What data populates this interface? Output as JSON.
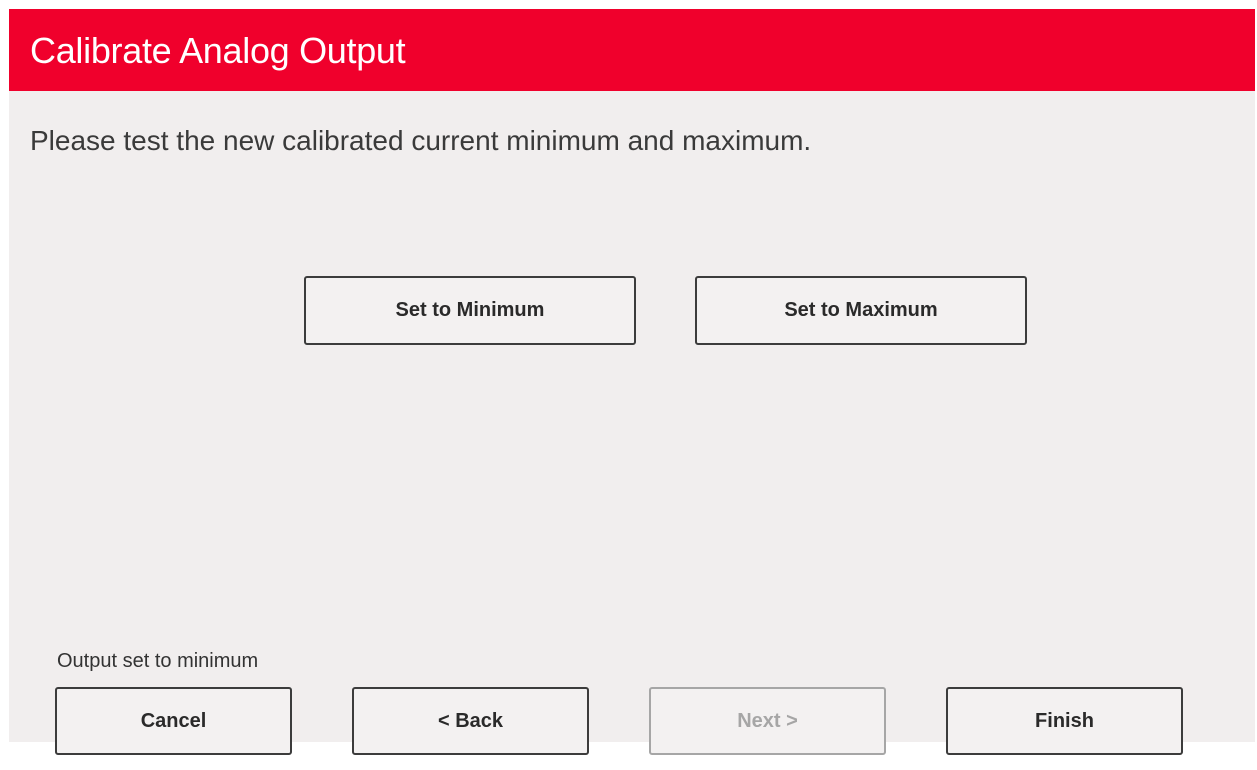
{
  "window": {
    "title": "Calibrate Analog Output",
    "accent_color": "#f0002c",
    "background_color": "#f1eeee"
  },
  "content": {
    "instruction": "Please test the new calibrated current minimum and maximum.",
    "set_minimum_label": "Set to Minimum",
    "set_maximum_label": "Set to Maximum",
    "status_text": "Output set to minimum"
  },
  "footer": {
    "cancel_label": "Cancel",
    "back_label": "< Back",
    "next_label": "Next >",
    "next_enabled": false,
    "finish_label": "Finish"
  }
}
